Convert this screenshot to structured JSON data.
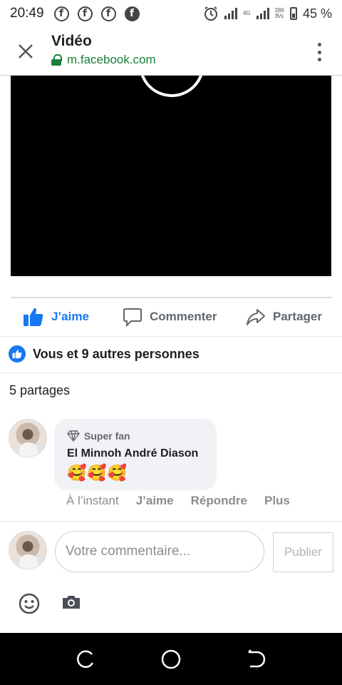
{
  "status_bar": {
    "time": "20:49",
    "network_type": "4G",
    "speed_value": "286",
    "speed_unit": "B/s",
    "battery": "45 %",
    "fb_icon_letter": "f"
  },
  "browser": {
    "title": "Vidéo",
    "url": "m.facebook.com"
  },
  "actions": {
    "like": "J’aime",
    "comment": "Commenter",
    "share": "Partager"
  },
  "reactions": {
    "text": "Vous et 9 autres personnes"
  },
  "shares": {
    "text": "5 partages"
  },
  "comment": {
    "badge": "Super fan",
    "author": "El Minnoh André Diason",
    "text": "🥰🥰🥰",
    "time": "À l’instant",
    "like": "J’aime",
    "reply": "Répondre",
    "more": "Plus"
  },
  "composer": {
    "placeholder": "Votre commentaire...",
    "publish": "Publier"
  },
  "colors": {
    "facebook_blue": "#1877f2",
    "secure_green": "#188038"
  }
}
